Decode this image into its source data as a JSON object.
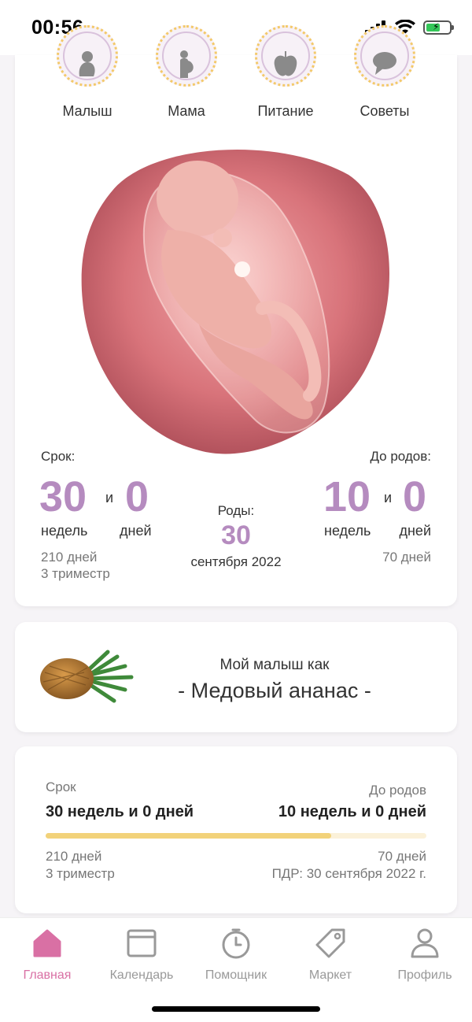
{
  "status": {
    "time": "00:56"
  },
  "categories": [
    {
      "label": "Малыш",
      "icon": "baby-icon"
    },
    {
      "label": "Мама",
      "icon": "mother-icon"
    },
    {
      "label": "Питание",
      "icon": "apple-icon"
    },
    {
      "label": "Советы",
      "icon": "speech-bubble-icon"
    }
  ],
  "term": {
    "label": "Срок:",
    "weeks": "30",
    "and": "и",
    "days": "0",
    "weeks_unit": "недель",
    "days_unit": "дней",
    "total_days": "210 дней",
    "trimester": "3 триместр"
  },
  "due": {
    "label": "Роды:",
    "day": "30",
    "month_year": "сентября 2022"
  },
  "remaining": {
    "label": "До родов:",
    "weeks": "10",
    "and": "и",
    "days": "0",
    "weeks_unit": "недель",
    "days_unit": "дней",
    "total_days": "70 дней"
  },
  "fruit": {
    "subtitle": "Мой малыш как",
    "name": "- Медовый ананас -"
  },
  "progress": {
    "term_label": "Срок",
    "term_value": "30 недель и 0 дней",
    "remaining_label": "До родов",
    "remaining_value": "10 недель и 0 дней",
    "fraction": 0.75,
    "days": "210 дней",
    "trimester": "3 триместр",
    "remaining_days": "70 дней",
    "pdr": "ПДР: 30 сентября 2022 г."
  },
  "tabs": [
    {
      "label": "Главная",
      "icon": "home-icon",
      "active": true
    },
    {
      "label": "Календарь",
      "icon": "calendar-icon",
      "active": false
    },
    {
      "label": "Помощник",
      "icon": "timer-icon",
      "active": false
    },
    {
      "label": "Маркет",
      "icon": "tag-icon",
      "active": false
    },
    {
      "label": "Профиль",
      "icon": "profile-icon",
      "active": false
    }
  ],
  "colors": {
    "accent": "#b58bbf",
    "tab_active": "#d970a4",
    "progress": "#f2d27a"
  }
}
